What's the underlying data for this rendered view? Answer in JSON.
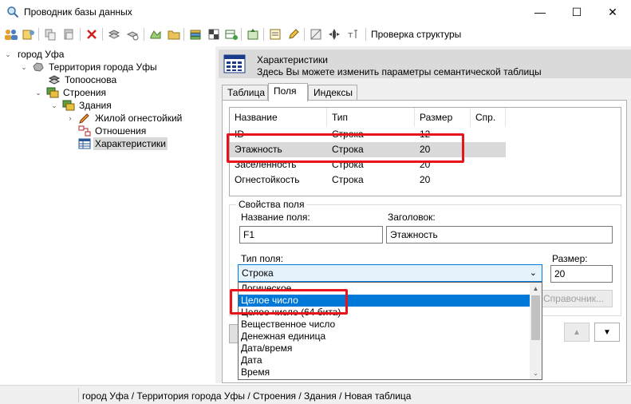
{
  "window": {
    "title": "Проводник базы данных",
    "minimize": "—",
    "maximize": "☐",
    "close": "✕"
  },
  "toolbar": {
    "structure_check": "Проверка структуры"
  },
  "tree": {
    "items": [
      {
        "label": "город Уфа"
      },
      {
        "label": "Территория города Уфы"
      },
      {
        "label": "Топооснова"
      },
      {
        "label": "Строения"
      },
      {
        "label": "Здания"
      },
      {
        "label": "Жилой огнестойкий"
      },
      {
        "label": "Отношения"
      },
      {
        "label": "Характеристики"
      }
    ]
  },
  "header": {
    "title": "Характеристики",
    "subtitle": "Здесь Вы можете изменить параметры семантической таблицы"
  },
  "tabs": [
    {
      "label": "Таблица"
    },
    {
      "label": "Поля"
    },
    {
      "label": "Индексы"
    }
  ],
  "fields_table": {
    "columns": [
      "Название",
      "Тип",
      "Размер",
      "Спр."
    ],
    "rows": [
      {
        "name": "ID",
        "type": "Строка",
        "size": "12"
      },
      {
        "name": "Этажность",
        "type": "Строка",
        "size": "20"
      },
      {
        "name": "Заселенность",
        "type": "Строка",
        "size": "20"
      },
      {
        "name": "Огнестойкость",
        "type": "Строка",
        "size": "20"
      }
    ]
  },
  "field_props": {
    "group_label": "Свойства поля",
    "name_label": "Название поля:",
    "name_value": "F1",
    "caption_label": "Заголовок:",
    "caption_value": "Этажность",
    "type_label": "Тип поля:",
    "type_value": "Строка",
    "size_label": "Размер:",
    "size_value": "20",
    "reference_button": "Справочник..."
  },
  "type_dropdown": {
    "options": [
      "Логическое",
      "Целое число",
      "Целое число (64 бита)",
      "Вещественное число",
      "Денежная единица",
      "Дата/время",
      "Дата",
      "Время"
    ],
    "selected_index": 1
  },
  "statusbar": {
    "path": "город Уфа / Территория города Уфы / Строения / Здания / Новая таблица"
  },
  "colors": {
    "accent": "#0078d7",
    "highlight_box": "#e8141c",
    "selection_gray": "#d9d9d9"
  }
}
